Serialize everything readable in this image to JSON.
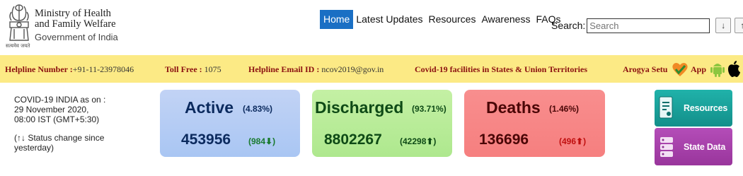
{
  "header": {
    "ministry_line1": "Ministry of Health",
    "ministry_line2": "and Family Welfare",
    "government": "Government of India",
    "emblem_motto": "सत्यमेव जयते"
  },
  "nav": {
    "items": [
      "Home",
      "Latest Updates",
      "Resources",
      "Awareness",
      "FAQs"
    ],
    "active": "Home"
  },
  "search": {
    "label": "Search:",
    "placeholder": "Search",
    "down_label": "↓",
    "up_label": "↑"
  },
  "helpline": {
    "number_label": "Helpline Number :",
    "number_value": "+91-11-23978046",
    "tollfree_label": "Toll Free :",
    "tollfree_value": "1075",
    "email_label": "Helpline Email ID :",
    "email_value": "ncov2019@gov.in",
    "facilities": "Covid-19 facilities in States & Union Territories",
    "arogya": "Arogya Setu",
    "app": "App"
  },
  "info": {
    "line1": "COVID-19 INDIA as on :",
    "line2": "29 November 2020,",
    "line3": "08:00 IST (GMT+5:30)",
    "status1": "(↑↓ Status change since",
    "status2": "yesterday)"
  },
  "cards": {
    "active": {
      "label": "Active",
      "pct": "(4.83%)",
      "value": "453956",
      "delta": "(984",
      "delta_dir": "down"
    },
    "discharged": {
      "label": "Discharged",
      "pct": "(93.71%)",
      "value": "8802267",
      "delta": "(42298",
      "delta_dir": "up"
    },
    "deaths": {
      "label": "Deaths",
      "pct": "(1.46%)",
      "value": "136696",
      "delta": "(496",
      "delta_dir": "up"
    }
  },
  "side_buttons": {
    "resources": "Resources",
    "state_data": "State Data"
  },
  "colors": {
    "nav_active": "#1a6fc4",
    "helpline_bar": "#fcea85",
    "helpline_text": "#8b1010",
    "active_card": "#b6cdf4",
    "discharged_card": "#b8ec98",
    "deaths_card": "#f78787",
    "resources_button": "#1aa39d",
    "state_button": "#a940ac"
  }
}
